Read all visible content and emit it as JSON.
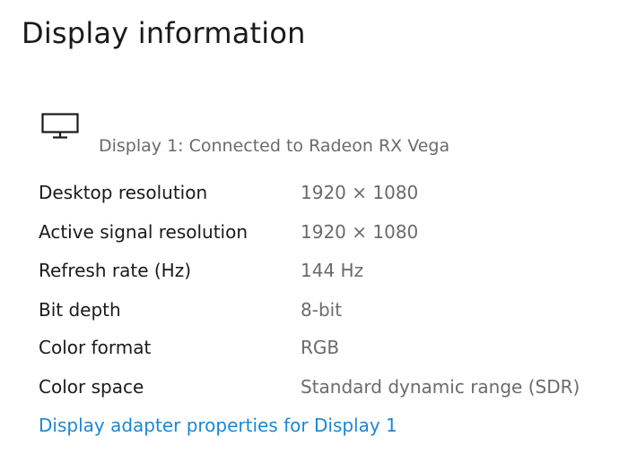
{
  "page": {
    "title": "Display information"
  },
  "display": {
    "icon": "monitor-icon",
    "subtitle": "Display 1: Connected to Radeon RX Vega"
  },
  "info": [
    {
      "label": "Desktop resolution",
      "value": "1920 × 1080"
    },
    {
      "label": "Active signal resolution",
      "value": "1920 × 1080"
    },
    {
      "label": "Refresh rate (Hz)",
      "value": "144 Hz"
    },
    {
      "label": "Bit depth",
      "value": "8-bit"
    },
    {
      "label": "Color format",
      "value": "RGB"
    },
    {
      "label": "Color space",
      "value": "Standard dynamic range (SDR)"
    }
  ],
  "link": {
    "adapter_properties": "Display adapter properties for Display 1"
  },
  "colors": {
    "link": "#1b87d6",
    "secondary_text": "#6b6b6b",
    "primary_text": "#1a1a1a"
  }
}
